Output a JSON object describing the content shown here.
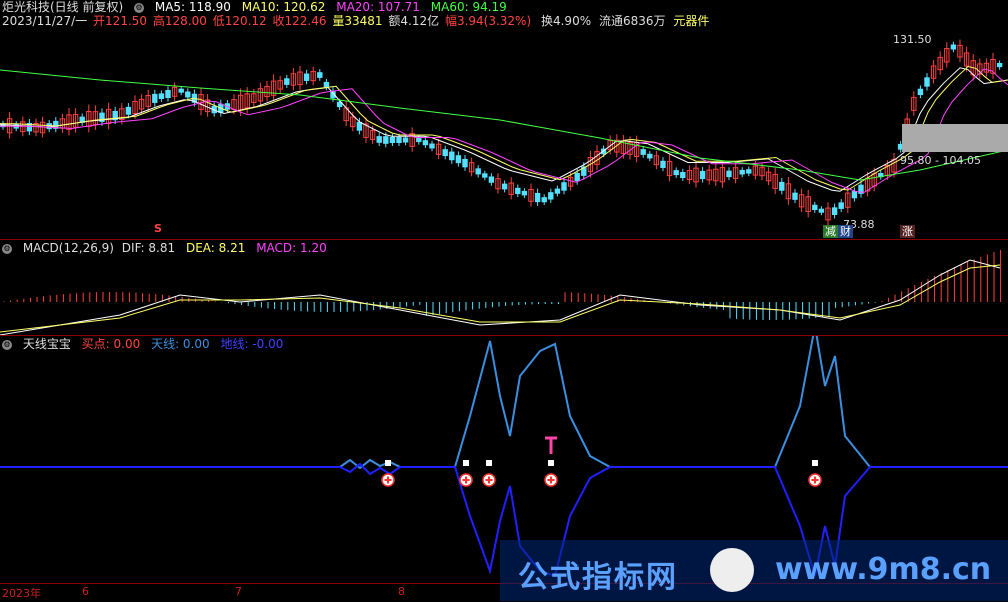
{
  "main": {
    "title": "炬光科技(日线 前复权)",
    "ma": [
      {
        "label": "MA5: 118.90",
        "color": "#ffffff"
      },
      {
        "label": "MA10: 120.62",
        "color": "#ffff66"
      },
      {
        "label": "MA20: 107.71",
        "color": "#ff44ff"
      },
      {
        "label": "MA60: 94.19",
        "color": "#44ff44"
      }
    ],
    "date": "2023/11/27/一",
    "quote": [
      {
        "label": "开121.50",
        "color": "#ff4040"
      },
      {
        "label": "高128.00",
        "color": "#ff4040"
      },
      {
        "label": "低120.12",
        "color": "#ff4040"
      },
      {
        "label": "收122.46",
        "color": "#ff4040"
      },
      {
        "label": "量33481",
        "color": "#ffff66"
      },
      {
        "label": "额4.12亿",
        "color": "#dddddd"
      },
      {
        "label": "幅3.94(3.32%)",
        "color": "#ff4040"
      },
      {
        "label": "换4.90%",
        "color": "#dddddd"
      },
      {
        "label": "流通6836万",
        "color": "#dddddd"
      },
      {
        "label": "元器件",
        "color": "#ffff66"
      }
    ],
    "high_label": "131.50",
    "low_label": "73.88",
    "range_label": "95.80 - 104.05",
    "signal_s": "S",
    "badges": [
      {
        "text": "减",
        "color": "#44bb44"
      },
      {
        "text": "财",
        "color": "#4488ff"
      },
      {
        "text": "涨",
        "color": "#ff4040"
      }
    ]
  },
  "macd": {
    "title": "MACD(12,26,9)",
    "dif": "DIF: 8.81",
    "dea": "DEA: 8.21",
    "macd": "MACD: 1.20"
  },
  "indicator": {
    "title": "天线宝宝",
    "buy": "买点: 0.00",
    "sky": "天线: 0.00",
    "ground": "地线: -0.00"
  },
  "axis": {
    "ticks": [
      "2023年",
      "6",
      "7",
      "8"
    ]
  },
  "watermark": {
    "text1": "公式指标网",
    "text2": "www.9m8.cn"
  }
}
